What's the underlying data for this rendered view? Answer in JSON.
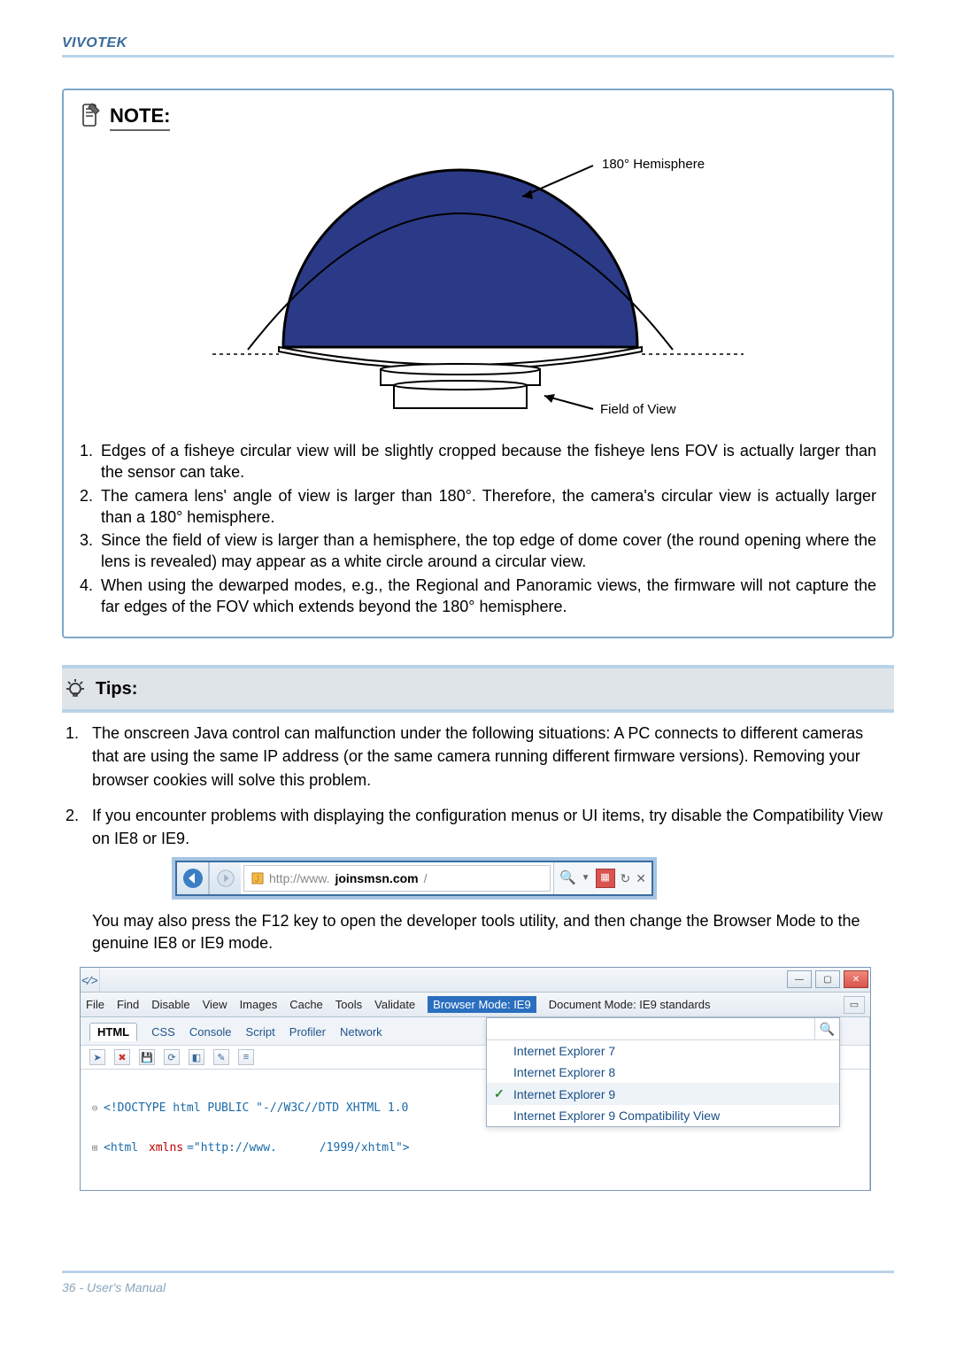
{
  "brand": "VIVOTEK",
  "note": {
    "title": "NOTE:",
    "diagram": {
      "hemisphere_label": "180° Hemisphere",
      "fov_label": "Field of View"
    },
    "items": [
      "Edges of a fisheye circular view will be slightly cropped because the fisheye lens FOV is actually larger than the sensor can take.",
      "The camera lens' angle of view is larger than 180°. Therefore, the camera's circular view is actually larger than a 180° hemisphere.",
      "Since the field of view is larger than a hemisphere, the top edge of dome cover (the round opening where the lens is revealed) may appear as a white circle around a circular view.",
      "When using the dewarped modes, e.g., the Regional and Panoramic views, the firmware will not capture the far edges of the FOV which extends beyond the 180° hemisphere."
    ]
  },
  "tips": {
    "title": "Tips:",
    "items": [
      "The onscreen Java control can malfunction under the following situations: A PC connects to different cameras that are using the same IP address (or the same camera running different firmware versions). Removing your browser cookies will solve this problem.",
      "If you encounter problems with displaying the configuration menus or UI items, try disable the Compatibility View on IE8 or IE9."
    ],
    "after_ie": "You may also press the F12 key to open the developer tools utility, and then change the Browser Mode to the genuine IE8 or IE9 mode."
  },
  "ie_addr": {
    "prefix": "http://www.",
    "bold": "joinsmsn.com",
    "suffix": "/"
  },
  "devtools": {
    "menus": [
      "File",
      "Find",
      "Disable",
      "View",
      "Images",
      "Cache",
      "Tools",
      "Validate"
    ],
    "browser_mode": "Browser Mode: IE9",
    "document_mode": "Document Mode: IE9 standards",
    "tabs": [
      "HTML",
      "CSS",
      "Console",
      "Script",
      "Profiler",
      "Network"
    ],
    "code_line1": "<!DOCTYPE html PUBLIC \"-//W3C//DTD XHTML 1.0 ",
    "code_line2a": "<html ",
    "code_line2b": "xmlns",
    "code_line2c": "=\"http://www.",
    "code_line2d": "/1999/xhtml\">",
    "dropdown": [
      "Internet Explorer 7",
      "Internet Explorer 8",
      "Internet Explorer 9",
      "Internet Explorer 9 Compatibility View"
    ],
    "selected_index": 2
  },
  "footer": "36 - User's Manual"
}
